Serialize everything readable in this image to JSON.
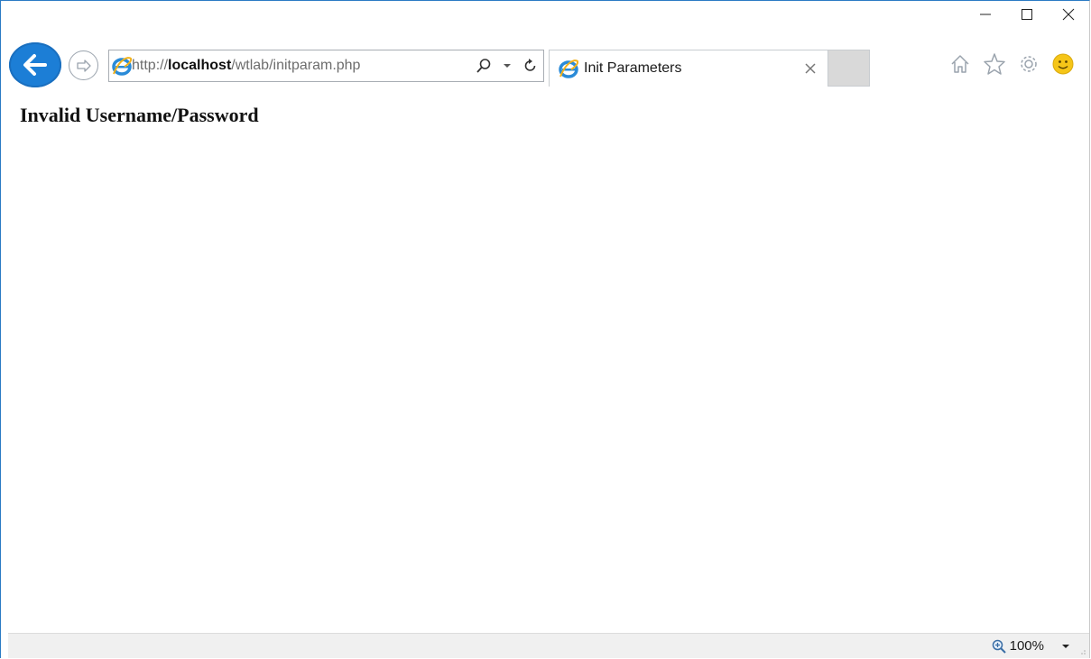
{
  "browser": {
    "address": {
      "scheme": "http://",
      "host": "localhost",
      "path": "/wtlab/initparam.php"
    },
    "tab": {
      "title": "Init Parameters"
    },
    "zoom_label": "100%"
  },
  "page": {
    "message": "Invalid Username/Password"
  },
  "colors": {
    "accent": "#1c7ed6",
    "status_bar": "#f0f0f0",
    "window_border": "#2b7bc4"
  },
  "icons": [
    "back-arrow-icon",
    "forward-arrow-icon",
    "ie-logo-icon",
    "search-icon",
    "dropdown-icon",
    "refresh-icon",
    "close-tab-icon",
    "home-icon",
    "favorites-star-icon",
    "settings-gear-icon",
    "smiley-feedback-icon",
    "zoom-icon",
    "minimize-icon",
    "maximize-icon",
    "close-icon"
  ]
}
